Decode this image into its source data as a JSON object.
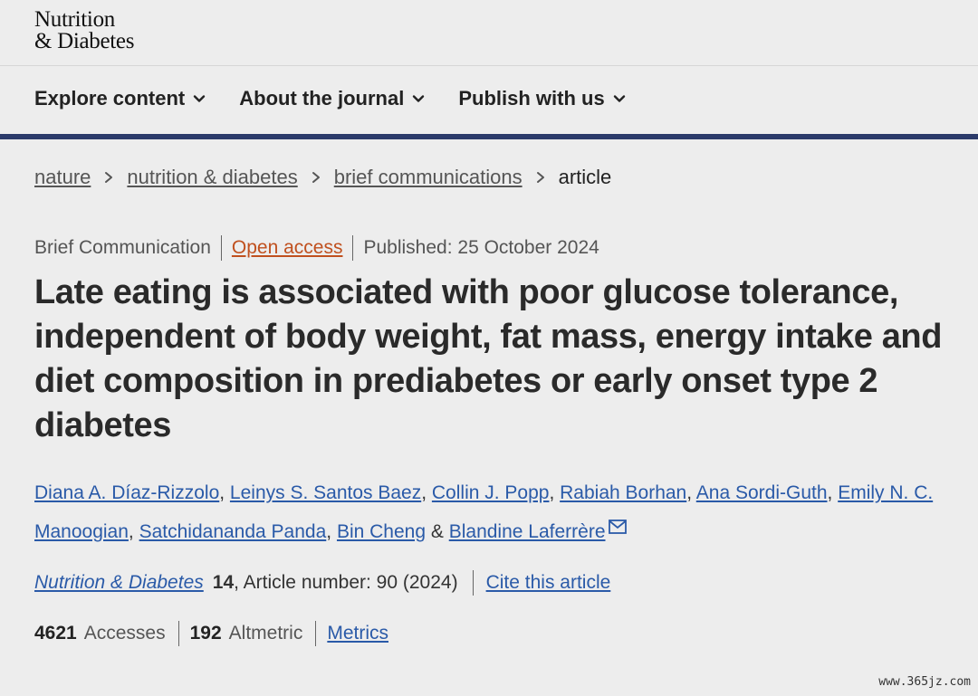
{
  "logo": {
    "line1": "Nutrition",
    "line2": "& Diabetes"
  },
  "nav": [
    {
      "label": "Explore content"
    },
    {
      "label": "About the journal"
    },
    {
      "label": "Publish with us"
    }
  ],
  "breadcrumb": [
    "nature",
    "nutrition & diabetes",
    "brief communications",
    "article"
  ],
  "meta": {
    "type": "Brief Communication",
    "access": "Open access",
    "published": "Published: 25 October 2024"
  },
  "title": "Late eating is associated with poor glucose tolerance, independent of body weight, fat mass, energy intake and diet composition in prediabetes or early onset type 2 diabetes",
  "authors": [
    "Diana A. Díaz-Rizzolo",
    "Leinys S. Santos Baez",
    "Collin J. Popp",
    "Rabiah Borhan",
    "Ana Sordi-Guth",
    "Emily N. C. Manoogian",
    "Satchidananda Panda",
    "Bin Cheng",
    "Blandine Laferrère"
  ],
  "author_separators": {
    "comma": ", ",
    "amp": " & "
  },
  "citation": {
    "journal": "Nutrition & Diabetes",
    "volume": "14",
    "article": ", Article number: 90 (2024)",
    "cite_label": "Cite this article"
  },
  "metrics": {
    "accesses_value": "4621",
    "accesses_label": "Accesses",
    "altmetric_value": "192",
    "altmetric_label": "Altmetric",
    "metrics_label": "Metrics"
  },
  "watermark": "www.365jz.com",
  "colors": {
    "nav_bar": "#2b3a6a",
    "link": "#2a5aa8",
    "open_access": "#c0501e"
  },
  "icons": {
    "nav": "chevron-down-icon",
    "breadcrumb": "chevron-right-icon",
    "corresponding": "mail-icon"
  }
}
